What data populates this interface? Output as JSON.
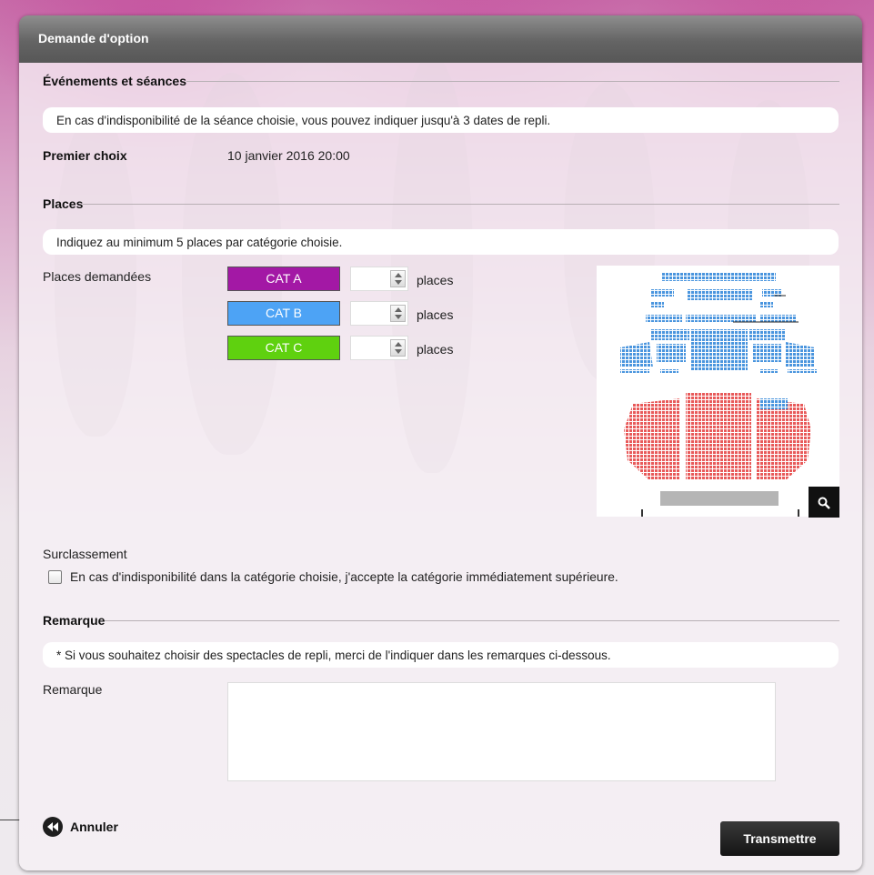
{
  "dialog": {
    "title": "Demande d'option"
  },
  "events": {
    "heading": "Événements et séances",
    "note": "En cas d'indisponibilité de la séance choisie, vous pouvez indiquer jusqu'à 3 dates de repli.",
    "first_choice_label": "Premier choix",
    "first_choice_value": "10 janvier 2016 20:00"
  },
  "places": {
    "heading": "Places",
    "note": "Indiquez au minimum 5 places par catégorie choisie.",
    "requested_label": "Places demandées",
    "unit": "places",
    "categories": [
      {
        "label": "CAT A",
        "color": "#a318a5",
        "value": ""
      },
      {
        "label": "CAT B",
        "color": "#4da3f5",
        "value": ""
      },
      {
        "label": "CAT C",
        "color": "#5fd10f",
        "value": ""
      }
    ],
    "seat_colors": {
      "upper": "#4a95de",
      "lower": "#e85a5a",
      "stage": "#b5b5b5"
    }
  },
  "upgrade": {
    "label": "Surclassement",
    "checkbox_label": "En cas d'indisponibilité dans la catégorie choisie, j'accepte la catégorie immédiatement supérieure.",
    "checked": false
  },
  "remark": {
    "heading": "Remarque",
    "note": "* Si vous souhaitez choisir des spectacles de repli, merci de l'indiquer dans les remarques ci-dessous.",
    "field_label": "Remarque",
    "value": ""
  },
  "actions": {
    "cancel_label": "Annuler",
    "submit_label": "Transmettre"
  }
}
